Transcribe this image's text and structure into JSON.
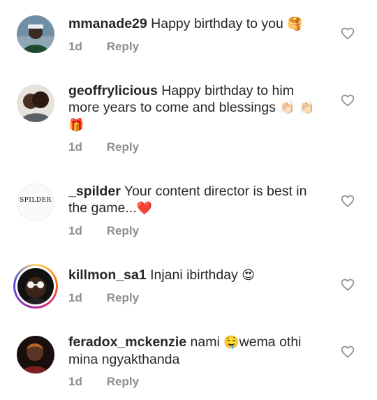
{
  "comments": [
    {
      "username": "mmanade29",
      "text": "Happy birthday to you",
      "emoji": "🥞",
      "time": "1d",
      "reply_label": "Reply"
    },
    {
      "username": "geoffrylicious",
      "text": "Happy birthday to him more years to come and blessings",
      "emoji": "👏🏻",
      "emoji2": "👏🏻🎁",
      "time": "1d",
      "reply_label": "Reply"
    },
    {
      "username": "_spilder",
      "text": "Your content director is best in the game...",
      "emoji": "❤️",
      "avatar_logo": "SPILDER",
      "time": "1d",
      "reply_label": "Reply"
    },
    {
      "username": "killmon_sa1",
      "text": "Injani ibirthday",
      "emoji": "😍",
      "time": "1d",
      "reply_label": "Reply"
    },
    {
      "username": "feradox_mckenzie",
      "text_before": "nami",
      "emoji": "🤤",
      "text": "wema othi mina ngyakthanda",
      "time": "1d",
      "reply_label": "Reply"
    }
  ],
  "icons": {
    "like": "heart-outline-icon"
  },
  "colors": {
    "text": "#262626",
    "meta": "#8e8e8e",
    "heart_outline": "#8e8e8e",
    "red_heart": "#e0243b"
  }
}
